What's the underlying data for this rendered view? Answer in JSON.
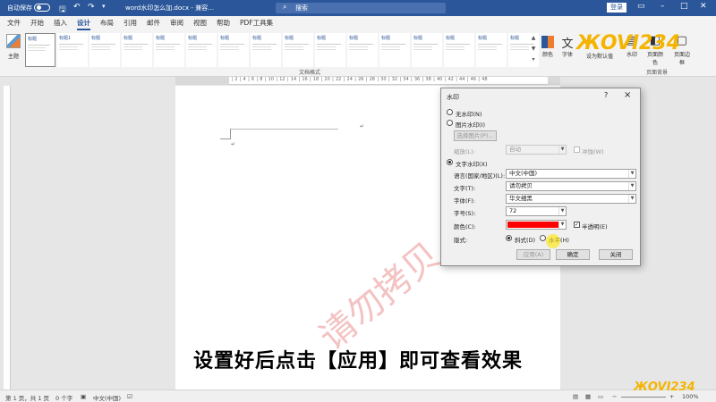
{
  "titlebar": {
    "autosave_label": "自动保存",
    "toggle_state": "关",
    "doc_title": "word水印怎么加.docx - 兼容…",
    "search_placeholder": "搜索",
    "login_label": "登录"
  },
  "tabs": [
    "文件",
    "开始",
    "插入",
    "设计",
    "布局",
    "引用",
    "邮件",
    "审阅",
    "视图",
    "帮助",
    "PDF工具集"
  ],
  "active_tab": "设计",
  "ribbon": {
    "theme_label": "主题",
    "gallery_items": [
      "标题",
      "标题1",
      "标题",
      "标题",
      "标题",
      "标题",
      "标题",
      "标题",
      "标题",
      "标题",
      "标题",
      "标题",
      "标题",
      "标题",
      "标题",
      "标题"
    ],
    "group_label_format": "文档格式",
    "colors_label": "颜色",
    "fonts_label": "字体",
    "fonts_symbol": "文",
    "effects_label": "设为默认值",
    "watermark_label": "水印",
    "page_color_label": "页面颜色",
    "page_borders_label": "页面边框",
    "group_label_page_bg": "页面背景"
  },
  "dialog": {
    "title": "水印",
    "help": "?",
    "close": "×",
    "no_watermark": "无水印(N)",
    "picture_watermark": "图片水印(I)",
    "select_picture": "选择图片(P)...",
    "scale_label": "缩放(L):",
    "scale_value": "自动",
    "washout_label": "冲蚀(W)",
    "text_watermark": "文字水印(X)",
    "language_label": "语言(国家/地区)(L):",
    "language_value": "中文(中国)",
    "text_label": "文字(T):",
    "text_value": "请勿拷贝",
    "font_label": "字体(F):",
    "font_value": "华文细黑",
    "size_label": "字号(S):",
    "size_value": "72",
    "color_label": "颜色(C):",
    "color_value": "#ff0000",
    "semitransparent_label": "半透明(E)",
    "layout_label": "版式:",
    "diagonal_label": "斜式(D)",
    "horizontal_label": "水平(H)",
    "apply_button": "应用(A)",
    "ok_button": "确定",
    "close_button": "关闭"
  },
  "watermark_text": "请勿拷贝",
  "caption": "设置好后点击【应用】即可查看效果",
  "statusbar": {
    "page": "第 1 页，共 1 页",
    "words": "0 个字",
    "language": "中文(中国)",
    "zoom": "100%"
  },
  "logo_text": "ЖOVI234",
  "logo_sub": "ЖOVI234"
}
